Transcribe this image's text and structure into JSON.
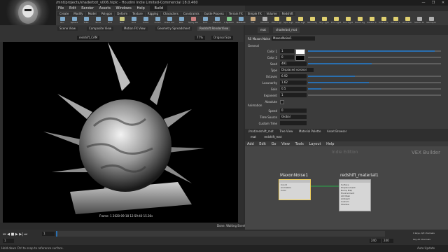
{
  "window": {
    "title": "/mnt/projects/shaderbot_v006.hiplc - Houdini Indie Limited-Commercial 18.0.460",
    "controls": [
      "—",
      "❐",
      "✕"
    ]
  },
  "menubar": {
    "items": [
      "File",
      "Edit",
      "Render",
      "Assets",
      "Windows",
      "Help"
    ]
  },
  "desktop": {
    "name": "Build"
  },
  "shelf": {
    "tabs": [
      "Create",
      "Modify",
      "Model",
      "Polygon",
      "Deform",
      "Texture",
      "Rigging",
      "Characters",
      "Constraints",
      "Guide Process",
      "Terrain FX",
      "Simple FX",
      "Volume",
      "Redshift"
    ],
    "tools": [
      {
        "label": "Box",
        "color": "#7fa9c9"
      },
      {
        "label": "Sphere",
        "color": "#7fa9c9"
      },
      {
        "label": "Tube",
        "color": "#7fa9c9"
      },
      {
        "label": "Torus",
        "color": "#7fa9c9"
      },
      {
        "label": "Grid",
        "color": "#7fa9c9"
      },
      {
        "label": "Null",
        "color": "#c9c97f"
      },
      {
        "label": "Line",
        "color": "#7fa9c9"
      },
      {
        "label": "Circle",
        "color": "#7fa9c9"
      },
      {
        "label": "Curve",
        "color": "#7fa9c9"
      },
      {
        "label": "Draw Curve",
        "color": "#7fa9c9"
      },
      {
        "label": "Path",
        "color": "#7fa9c9"
      },
      {
        "label": "Spray Paint",
        "color": "#c97f7f"
      },
      {
        "label": "Font",
        "color": "#7fa9c9"
      },
      {
        "label": "Platonic",
        "color": "#7fa9c9"
      },
      {
        "label": "L-System",
        "color": "#7fc98a"
      },
      {
        "label": "Metaball",
        "color": "#7fa9c9"
      },
      {
        "label": "File",
        "color": "#c9a97f"
      },
      {
        "label": "Camera",
        "color": "#b0b0b0"
      },
      {
        "label": "Point Light",
        "color": "#e0d070"
      },
      {
        "label": "Spot Light",
        "color": "#e0d070"
      },
      {
        "label": "Area Light",
        "color": "#e0d070"
      },
      {
        "label": "Geometry Light",
        "color": "#e0d070"
      },
      {
        "label": "Sky Light",
        "color": "#e0d070"
      },
      {
        "label": "Env Light",
        "color": "#e0d070"
      },
      {
        "label": "Sun Light",
        "color": "#e0d070"
      },
      {
        "label": "Portal Light",
        "color": "#e0d070"
      },
      {
        "label": "Caustic Light",
        "color": "#e0d070"
      },
      {
        "label": "Indirect Light",
        "color": "#e0d070"
      },
      {
        "label": "Volume Light",
        "color": "#e0d070"
      },
      {
        "label": "Ambient Light",
        "color": "#e0d070"
      },
      {
        "label": "Stereo Camera",
        "color": "#b0b0b0"
      },
      {
        "label": "Gamepad Camera",
        "color": "#b0b0b0"
      }
    ]
  },
  "viewport": {
    "tabs": [
      "Scene View",
      "Composite View",
      "Motion FX View",
      "Geometry Spreadsheet",
      "Redshift RenderView"
    ],
    "camera": "redshift_CAM",
    "zoom": "77%",
    "display": "Original Size",
    "frame_info": "Frame: 1   2020-09-18  12:59:40  15.36s",
    "status": "Done. Waiting Events"
  },
  "params": {
    "tabs": [
      "mat",
      "shaderbot_mat"
    ],
    "node_type": "RS Maxon Noise",
    "node_name": "MaxonNoise1",
    "section_general": "General",
    "rows": [
      {
        "label": "Color 1",
        "value": "1",
        "fill": 0.95,
        "swatch": "#ffffff"
      },
      {
        "label": "Color 2",
        "value": "0",
        "fill": 0.0,
        "swatch": "#000000"
      },
      {
        "label": "Seed",
        "value": "491",
        "fill": 0.48
      },
      {
        "label": "Type",
        "value": "Displaced voronoi",
        "fill": null
      },
      {
        "label": "Octaves",
        "value": "6.92",
        "fill": 0.35
      },
      {
        "label": "Lacunarity",
        "value": "1.62",
        "fill": 0.46
      },
      {
        "label": "Gain",
        "value": "0.5",
        "fill": 0.1
      },
      {
        "label": "Exponent",
        "value": "1",
        "fill": 0.0
      },
      {
        "label": "Absolute",
        "value": "",
        "fill": null
      }
    ],
    "section_animation": "Animation",
    "anim_rows": [
      {
        "label": "Speed",
        "value": "0"
      },
      {
        "label": "Time Source",
        "value": "Global"
      },
      {
        "label": "Custom Time",
        "value": ""
      }
    ]
  },
  "network": {
    "tabs": [
      "/mat/redshift_mat",
      "Tree View",
      "Material Palette",
      "Asset Browser"
    ],
    "path": [
      "mat",
      "redshift_mat"
    ],
    "menu": [
      "Add",
      "Edit",
      "Go",
      "View",
      "Tools",
      "Layout",
      "Help"
    ],
    "context_label": "Indie Edition",
    "builder_label": "VEX Builder",
    "nodes": [
      {
        "name": "MaxonNoise1",
        "ports": [
          "Coord",
          "Animation",
          "Color"
        ]
      },
      {
        "name": "redshift_material1",
        "ports": [
          "Surface",
          "Displacement",
          "Bump Map",
          "Environment",
          "AO Mask",
          "Ambient",
          "Custom",
          "Shadow"
        ]
      }
    ]
  },
  "timeline": {
    "frame": "1",
    "start": "1",
    "end": "240",
    "end2": "240",
    "keys": "0 keys, 0/0 channels",
    "key_all": "Key All Channels",
    "auto_update": "Auto Update"
  },
  "statusbar": {
    "text": "Hold down Ctrl to snap to reference surface."
  }
}
